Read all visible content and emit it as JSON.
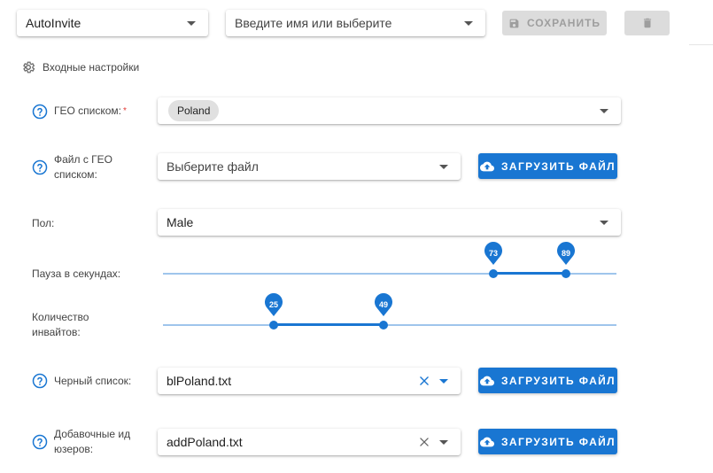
{
  "toolbar": {
    "profile_select": "AutoInvite",
    "name_select_placeholder": "Введите имя или выберите",
    "save_label": "СОХРАНИТЬ"
  },
  "section": {
    "title": "Входные настройки"
  },
  "fields": {
    "geo_list": {
      "label": "ГЕО списком:",
      "required_mark": "*",
      "chip": "Poland"
    },
    "geo_file": {
      "label_line1": "Файл с ГЕО",
      "label_line2": "списком:",
      "placeholder": "Выберите файл",
      "upload_label": "ЗАГРУЗИТЬ ФАЙЛ"
    },
    "gender": {
      "label": "Пол:",
      "value": "Male"
    },
    "pause": {
      "label": "Пауза в секундах:",
      "min": 73,
      "max": 89
    },
    "invites": {
      "label_line1": "Количество",
      "label_line2": "инвайтов:",
      "min": 25,
      "max": 49
    },
    "blacklist": {
      "label": "Черный список:",
      "value": "blPoland.txt",
      "upload_label": "ЗАГРУЗИТЬ ФАЙЛ"
    },
    "extra_ids": {
      "label_line1": "Добавочные ид",
      "label_line2": "юзеров:",
      "value": "addPoland.txt",
      "upload_label": "ЗАГРУЗИТЬ ФАЙЛ"
    }
  },
  "colors": {
    "accent": "#1976d2",
    "track": "#9fc5ec",
    "required": "#e53935",
    "disabled": "#dcdcdc"
  }
}
